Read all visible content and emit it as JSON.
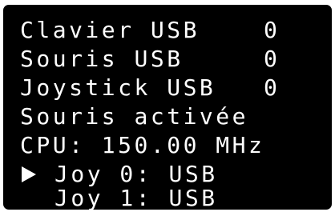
{
  "menu": {
    "items": [
      {
        "label": "Clavier USB",
        "value": "0"
      },
      {
        "label": "Souris USB",
        "value": "0"
      },
      {
        "label": "Joystick USB",
        "value": "0"
      },
      {
        "label": "Souris activée"
      },
      {
        "label": "CPU: 150.00 MHz"
      },
      {
        "label": "Joy 0: USB",
        "selected": true
      },
      {
        "label": "Joy 1: USB"
      }
    ],
    "cursor_icon": "triangle-right-icon"
  },
  "colors": {
    "background": "#000000",
    "text": "#ffffff"
  }
}
